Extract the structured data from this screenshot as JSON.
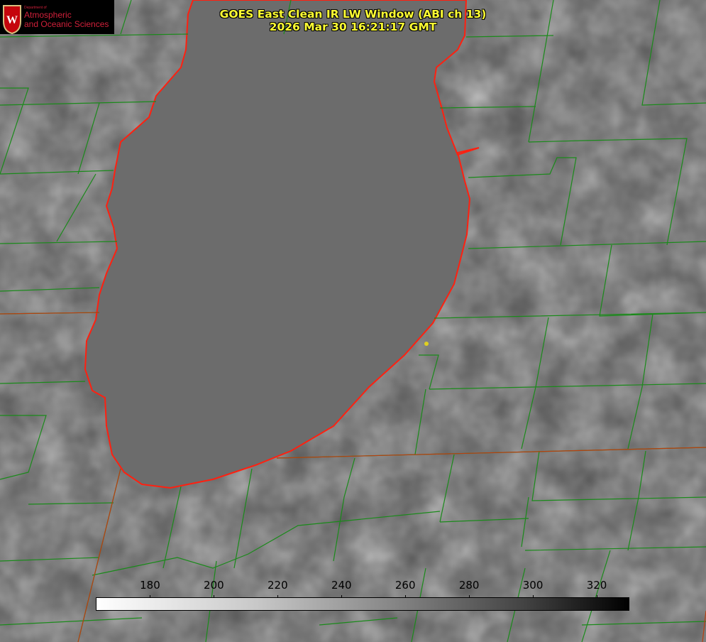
{
  "logo": {
    "dept": "Department of",
    "line1": "Atmospheric",
    "line2": "and Oceanic Sciences"
  },
  "title": {
    "line1": "GOES East Clean IR LW Window (ABI ch 13)",
    "line2": "2026 Mar 30 16:21:17 GMT"
  },
  "colorbar": {
    "ticks": [
      "180",
      "200",
      "220",
      "240",
      "260",
      "280",
      "300",
      "320"
    ],
    "range": [
      163,
      330
    ],
    "colors": {
      "low": "#ffffff",
      "high": "#000000"
    }
  },
  "colors": {
    "coastline": "#ff2010",
    "county": "#1a8a1a",
    "marker": "#e0d020"
  }
}
